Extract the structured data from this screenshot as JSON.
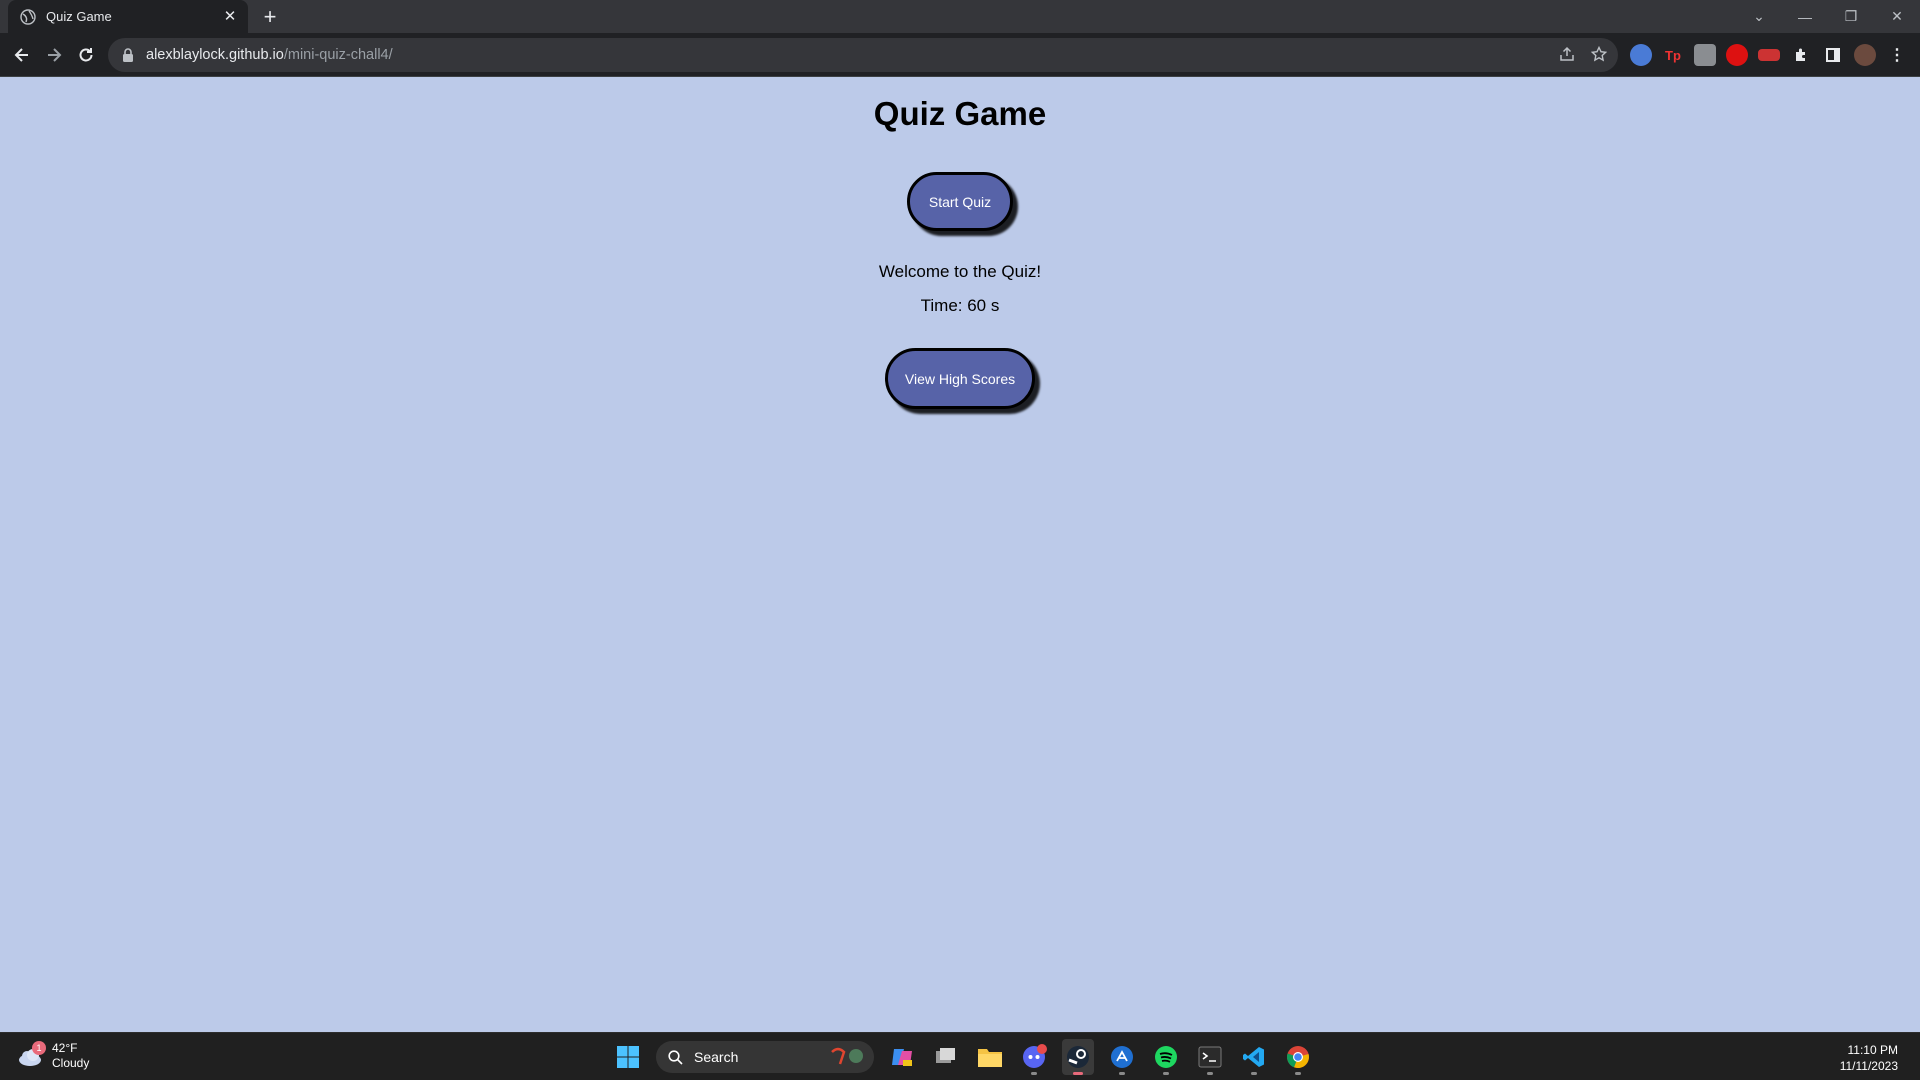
{
  "browser": {
    "tab_title": "Quiz Game",
    "url_host": "alexblaylock.github.io",
    "url_path": "/mini-quiz-chall4/",
    "new_tab_label": "+",
    "close_tab_label": "✕"
  },
  "page": {
    "title": "Quiz Game",
    "start_button": "Start Quiz",
    "welcome": "Welcome to the Quiz!",
    "timer": "Time: 60 s",
    "high_scores_button": "View High Scores",
    "colors": {
      "background": "#bccae9",
      "button": "#5763a8"
    }
  },
  "taskbar": {
    "weather_temp": "42°F",
    "weather_desc": "Cloudy",
    "weather_badge": "1",
    "search_label": "Search",
    "time": "11:10 PM",
    "date": "11/11/2023",
    "apps": [
      "copilot-icon",
      "task-view-icon",
      "file-explorer-icon",
      "discord-icon",
      "steam-icon",
      "app-store-icon",
      "spotify-icon",
      "terminal-icon",
      "vscode-icon",
      "chrome-icon"
    ]
  }
}
